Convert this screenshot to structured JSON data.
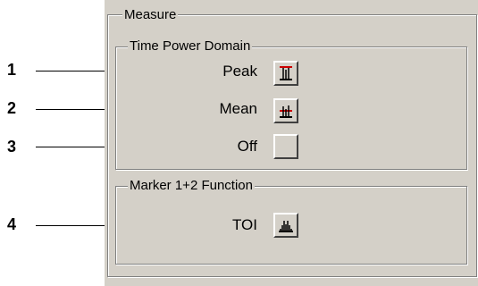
{
  "measure": {
    "title": "Measure",
    "time_power_domain": {
      "title": "Time Power Domain",
      "rows": [
        {
          "label": "Peak",
          "icon": "peak-icon",
          "callout": "1"
        },
        {
          "label": "Mean",
          "icon": "mean-icon",
          "callout": "2"
        },
        {
          "label": "Off",
          "icon": "off-icon",
          "callout": "3"
        }
      ]
    },
    "marker_function": {
      "title": "Marker 1+2 Function",
      "rows": [
        {
          "label": "TOI",
          "icon": "toi-icon",
          "callout": "4"
        }
      ]
    }
  }
}
